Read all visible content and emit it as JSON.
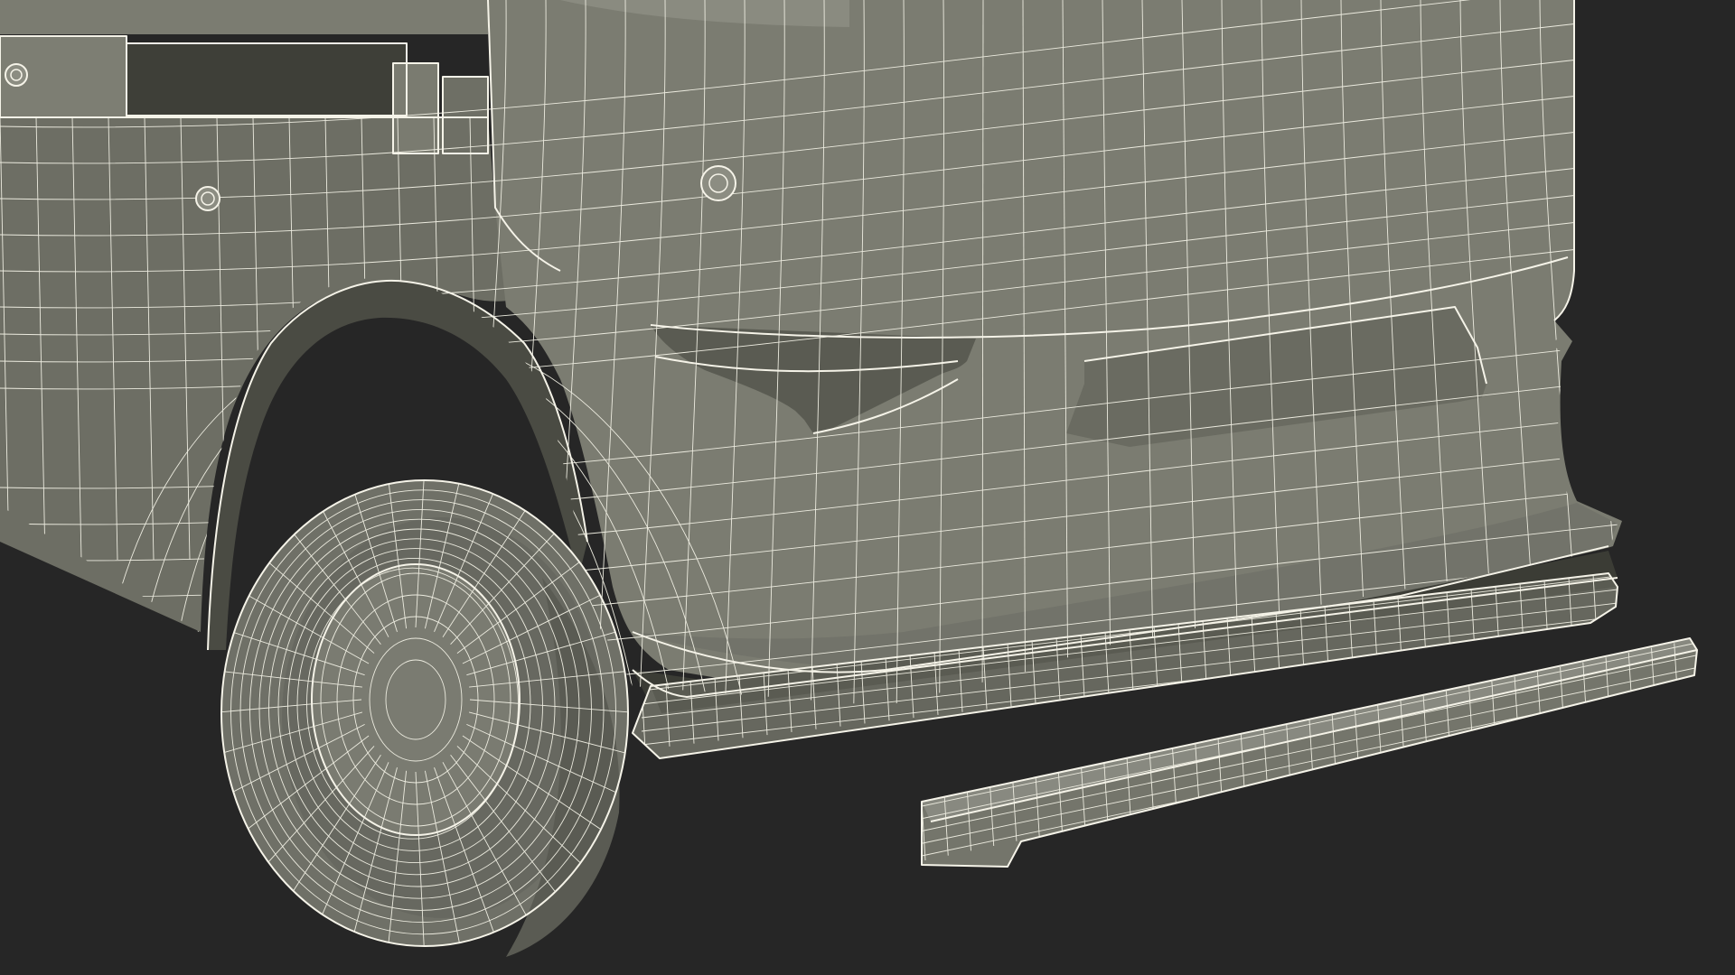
{
  "scene": {
    "subject": "",
    "colors": {
      "background": "#262626",
      "body": "#7b7c71",
      "body_shadow": "#5f6057",
      "body_dark": "#4b4c44",
      "tire": "#6f7067",
      "wireframe": "#f2f0e4"
    }
  }
}
